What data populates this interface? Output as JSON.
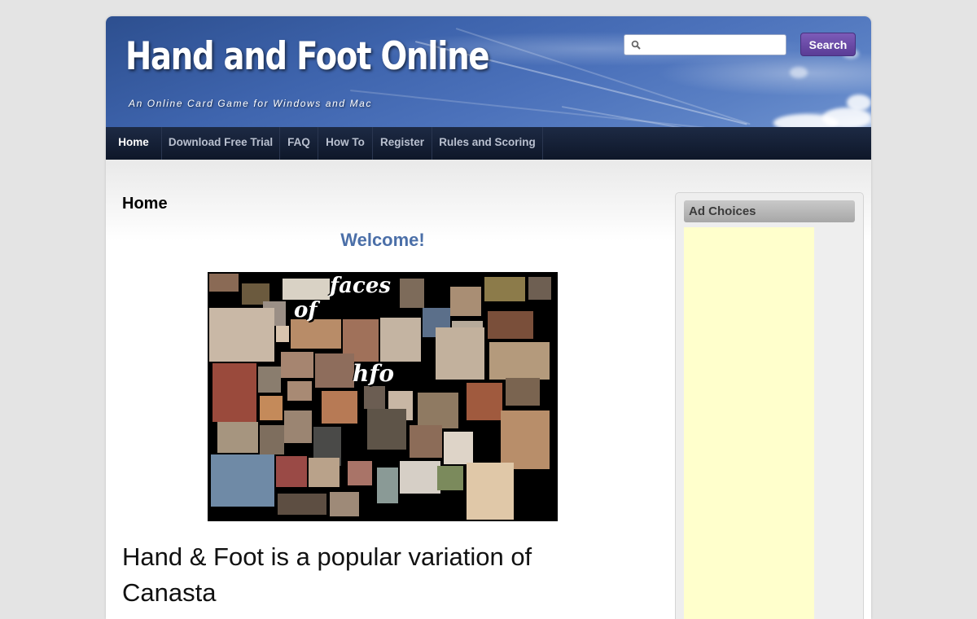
{
  "header": {
    "title": "Hand and Foot Online",
    "tagline": "An Online Card Game for Windows and Mac",
    "search": {
      "value": "",
      "button_label": "Search",
      "icon": "search-icon"
    }
  },
  "nav": {
    "items": [
      {
        "label": "Home",
        "active": true
      },
      {
        "label": "Download Free Trial",
        "active": false
      },
      {
        "label": "FAQ",
        "active": false
      },
      {
        "label": "How To",
        "active": false
      },
      {
        "label": "Register",
        "active": false
      },
      {
        "label": "Rules and Scoring",
        "active": false
      }
    ]
  },
  "main": {
    "heading": "Home",
    "welcome": "Welcome!",
    "collage_words": [
      "faces",
      "of",
      "hfo"
    ],
    "intro": "Hand & Foot is a popular variation of Canasta"
  },
  "sidebar": {
    "widget_title": "Ad Choices"
  },
  "colors": {
    "welcome": "#4b6fa8",
    "search_button": "#5a3c96",
    "nav_background": "#0e1729",
    "ad_background": "#ffffcc"
  }
}
